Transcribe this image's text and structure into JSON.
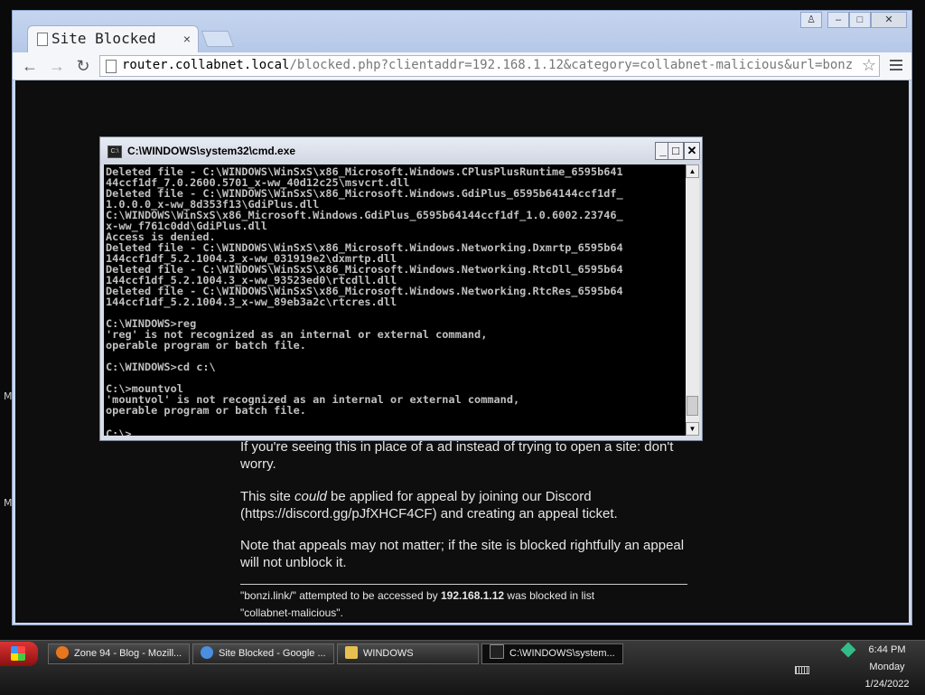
{
  "browser": {
    "tab_title": "Site Blocked",
    "tab_close": "×",
    "url_host": "router.collabnet.local",
    "url_path": "/blocked.php?clientaddr=192.168.1.12&category=collabnet-malicious&url=bonzi.link",
    "window_controls": {
      "user": "♙",
      "minimize": "–",
      "maximize": "□",
      "close": "✕"
    }
  },
  "page": {
    "para1": "If you're seeing this in place of a ad instead of trying to open a site: don't worry.",
    "para2_pre": "This site ",
    "para2_em": "could",
    "para2_post": " be applied for appeal by joining our Discord (https://discord.gg/pJfXHCF4CF) and creating an appeal ticket.",
    "para3": "Note that appeals may not matter; if the site is blocked rightfully an appeal will not unblock it.",
    "footer_pre": "\"bonzi.link/\" attempted to be accessed by ",
    "footer_ip": "192.168.1.12",
    "footer_mid": " was blocked in list",
    "footer_list": "\"collabnet-malicious\"."
  },
  "desktop": {
    "left_marks": [
      "M",
      "M"
    ]
  },
  "cmd": {
    "title": "C:\\WINDOWS\\system32\\cmd.exe",
    "icon_text": "C:\\",
    "buttons": {
      "minimize": "_",
      "maximize": "□",
      "close": "✕"
    },
    "lines": [
      "Deleted file - C:\\WINDOWS\\WinSxS\\x86_Microsoft.Windows.CPlusPlusRuntime_6595b641",
      "44ccf1df_7.0.2600.5701_x-ww_40d12c25\\msvcrt.dll",
      "Deleted file - C:\\WINDOWS\\WinSxS\\x86_Microsoft.Windows.GdiPlus_6595b64144ccf1df_",
      "1.0.0.0_x-ww_8d353f13\\GdiPlus.dll",
      "C:\\WINDOWS\\WinSxS\\x86_Microsoft.Windows.GdiPlus_6595b64144ccf1df_1.0.6002.23746_",
      "x-ww_f761c0dd\\GdiPlus.dll",
      "Access is denied.",
      "Deleted file - C:\\WINDOWS\\WinSxS\\x86_Microsoft.Windows.Networking.Dxmrtp_6595b64",
      "144ccf1df_5.2.1004.3_x-ww_031919e2\\dxmrtp.dll",
      "Deleted file - C:\\WINDOWS\\WinSxS\\x86_Microsoft.Windows.Networking.RtcDll_6595b64",
      "144ccf1df_5.2.1004.3_x-ww_93523ed0\\rtcdll.dll",
      "Deleted file - C:\\WINDOWS\\WinSxS\\x86_Microsoft.Windows.Networking.RtcRes_6595b64",
      "144ccf1df_5.2.1004.3_x-ww_89eb3a2c\\rtcres.dll",
      "",
      "C:\\WINDOWS>reg",
      "'reg' is not recognized as an internal or external command,",
      "operable program or batch file.",
      "",
      "C:\\WINDOWS>cd c:\\",
      "",
      "C:\\>mountvol",
      "'mountvol' is not recognized as an internal or external command,",
      "operable program or batch file.",
      ""
    ],
    "prompt": "C:\\>"
  },
  "taskbar": {
    "buttons": [
      {
        "label": "Zone 94 - Blog - Mozill...",
        "icon": "firefox-icon",
        "color": "#e8761f"
      },
      {
        "label": "Site Blocked - Google ...",
        "icon": "chrome-icon",
        "color": "#4a8fe0"
      },
      {
        "label": "WINDOWS",
        "icon": "folder-icon",
        "color": "#e8c050"
      },
      {
        "label": "C:\\WINDOWS\\system...",
        "icon": "cmd-icon",
        "color": "#222222"
      }
    ],
    "clock": {
      "time": "6:44 PM",
      "day": "Monday",
      "date": "1/24/2022"
    }
  }
}
